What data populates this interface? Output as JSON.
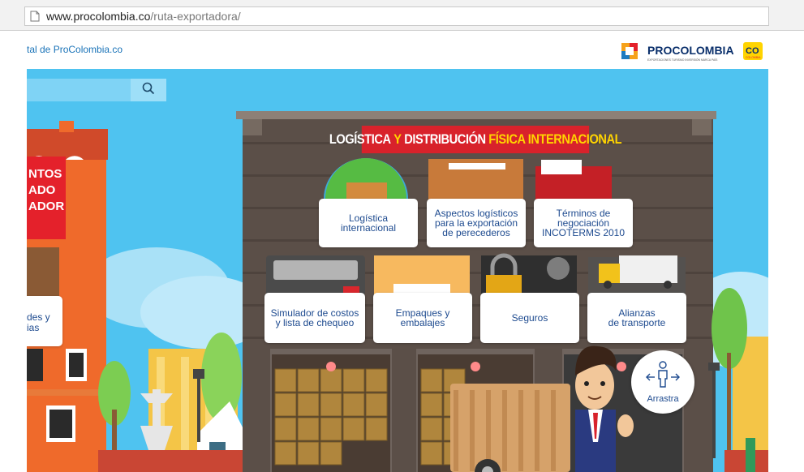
{
  "browser": {
    "url_host": "www.procolombia.co",
    "url_path": "/ruta-exportadora/"
  },
  "header": {
    "portal_link": "tal de ProColombia.co",
    "logo_name": "PROCOLOMBIA",
    "logo_tagline": "EXPORTACIONES TURISMO INVERSIÓN MARCA PAÍS",
    "logo_badge": "CO",
    "logo_badge_sub": "COLOMBIA"
  },
  "scene": {
    "banner_part1": "LOGÍSTICA",
    "banner_part2": "Y",
    "banner_part3": "DISTRIBUCIÓN",
    "banner_part4": "FÍSICA INTERNACIONAL",
    "left_red_line1": "NTOS",
    "left_red_line2": "ADO",
    "left_red_line3": "ADOR",
    "left_white_line1": "des y",
    "left_white_line2": "ias",
    "drag_label": "Arrastra",
    "cards": [
      {
        "line1": "Logística",
        "line2": "internacional",
        "line3": ""
      },
      {
        "line1": "Aspectos logísticos",
        "line2": "para la exportación",
        "line3": "de perecederos"
      },
      {
        "line1": "Términos de",
        "line2": "negociación",
        "line3": "INCOTERMS 2010"
      },
      {
        "line1": "Simulador de costos",
        "line2": "y lista de chequeo",
        "line3": ""
      },
      {
        "line1": "Empaques y",
        "line2": "embalajes",
        "line3": ""
      },
      {
        "line1": "Seguros",
        "line2": "",
        "line3": ""
      },
      {
        "line1": "Alianzas",
        "line2": "de transporte",
        "line3": ""
      }
    ]
  },
  "colors": {
    "sky": "#4fc3f0",
    "brick_dark": "#5b4f48",
    "banner_red": "#d8222b",
    "banner_yellow": "#ffd400",
    "card_text": "#1d4a8f"
  }
}
